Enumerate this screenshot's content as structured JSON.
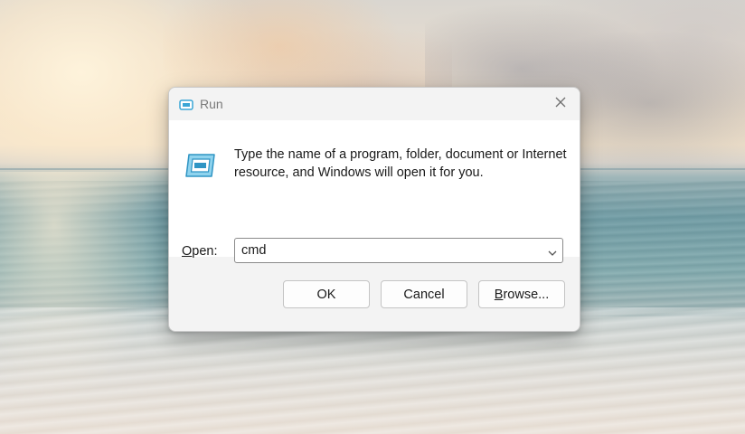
{
  "dialog": {
    "title": "Run",
    "close_icon": "close-icon",
    "app_icon": "run-icon",
    "description": "Type the name of a program, folder, document or Internet resource, and Windows will open it for you.",
    "open_label": "Open:",
    "open_value": "cmd",
    "ok_label": "OK",
    "cancel_label": "Cancel",
    "browse_label": "Browse..."
  },
  "colors": {
    "accent_icon": "#3aa6d6",
    "dialog_bg": "#f3f3f3",
    "content_bg": "#ffffff"
  }
}
